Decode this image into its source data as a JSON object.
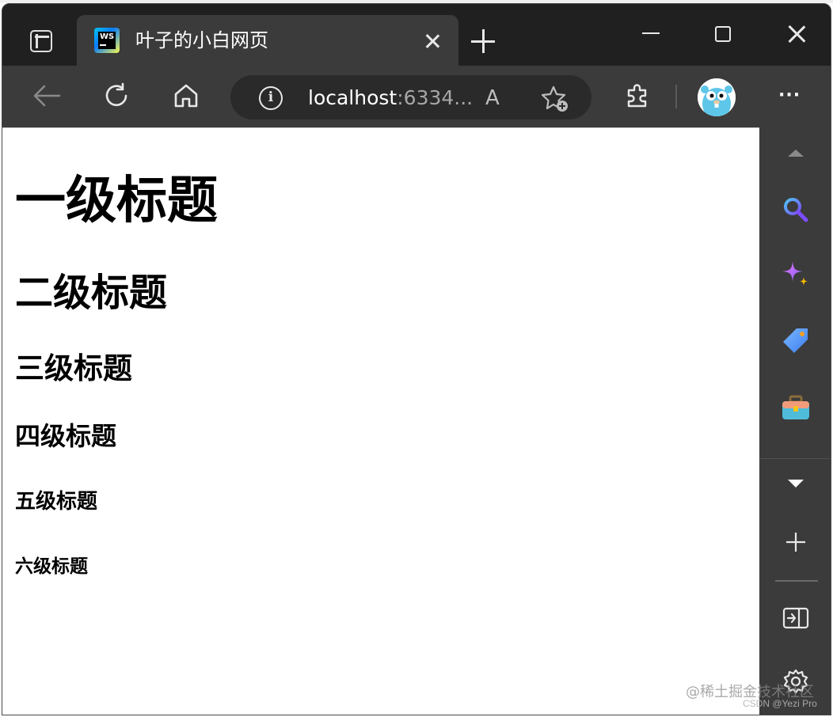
{
  "browser": {
    "tab": {
      "title": "叶子的小白网页",
      "favicon_text": "WS"
    },
    "address": {
      "host": "localhost",
      "port_truncated": ":6334..."
    },
    "icons": {
      "tab_actions": "tab-actions-icon",
      "close_tab": "close-icon",
      "new_tab": "plus-icon",
      "minimize": "minimize-icon",
      "maximize": "maximize-icon",
      "close_window": "close-icon",
      "back": "back-arrow-icon",
      "refresh": "refresh-icon",
      "home": "home-icon",
      "info": "info-icon",
      "read_aloud": "read-aloud-icon",
      "add_favorite": "add-favorite-icon",
      "extensions": "puzzle-icon",
      "profile": "avatar",
      "more": "more-icon"
    },
    "read_aloud_glyph": "A",
    "info_glyph": "i",
    "more_glyph": "···"
  },
  "page": {
    "h1": "一级标题",
    "h2": "二级标题",
    "h3": "三级标题",
    "h4": "四级标题",
    "h5": "五级标题",
    "h6": "六级标题"
  },
  "sidebar": {
    "items": [
      "scroll-up-icon",
      "search-icon",
      "copilot-icon",
      "shopping-tag-icon",
      "tools-icon",
      "scroll-down-icon",
      "add-icon",
      "split-screen-icon",
      "settings-icon"
    ]
  },
  "watermark": {
    "line1": "@稀土掘金技术社区",
    "line2": "CSDN @Yezi Pro"
  },
  "colors": {
    "frame": "#202020",
    "toolbar": "#3b3b3b",
    "address_bar": "#2a2a2a",
    "content_bg": "#ffffff"
  }
}
